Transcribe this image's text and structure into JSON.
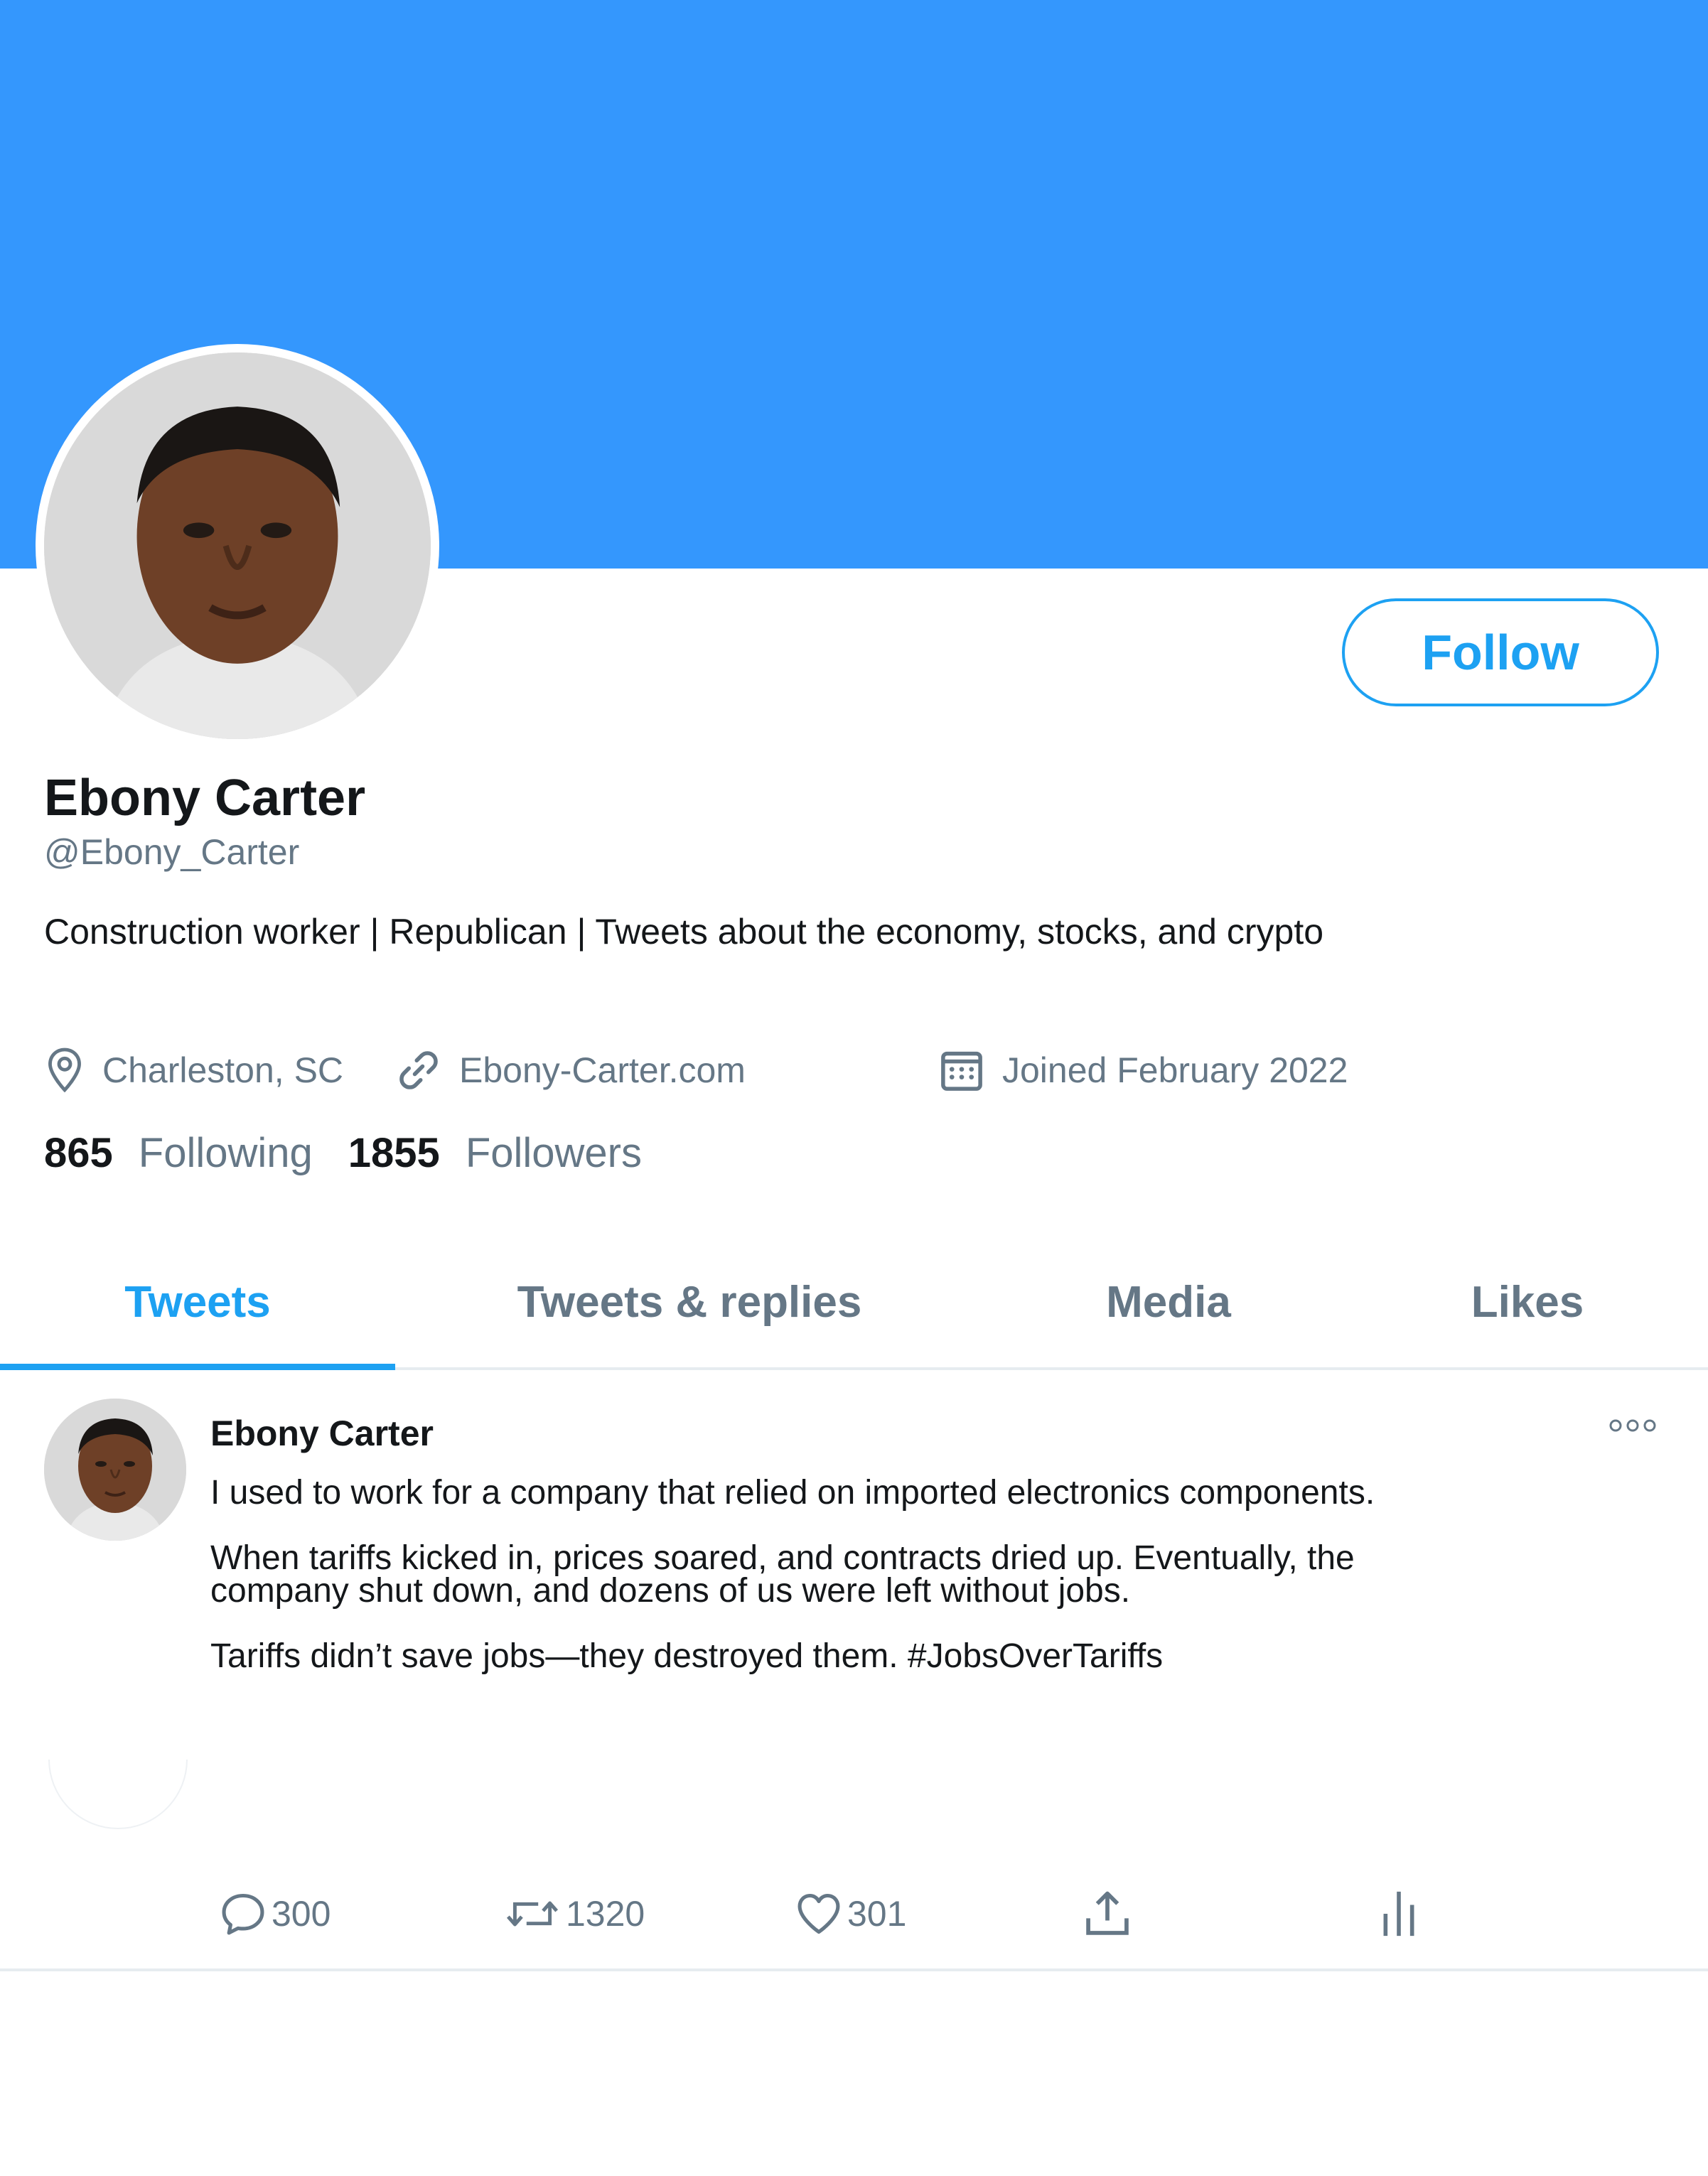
{
  "colors": {
    "banner": "#3497fd",
    "accent": "#1da1f2",
    "secondary_text": "#657786",
    "divider": "#e6ecf0"
  },
  "profile": {
    "name": "Ebony Carter",
    "handle": "@Ebony_Carter",
    "bio": "Construction worker |  Republican | Tweets about the economy, stocks, and crypto",
    "location": "Charleston, SC",
    "website": "Ebony-Carter.com",
    "joined": "Joined February 2022",
    "following_count": "865",
    "following_label": "Following",
    "followers_count": "1855",
    "followers_label": "Followers",
    "follow_label": "Follow"
  },
  "icons": {
    "location": "location-pin-icon",
    "link": "link-icon",
    "calendar": "calendar-icon",
    "more": "more-options-icon",
    "reply": "reply-icon",
    "retweet": "retweet-icon",
    "like": "heart-icon",
    "share": "share-icon",
    "analytics": "analytics-icon"
  },
  "tabs": [
    {
      "label": "Tweets",
      "active": true
    },
    {
      "label": "Tweets & replies",
      "active": false
    },
    {
      "label": "Media",
      "active": false
    },
    {
      "label": "Likes",
      "active": false
    }
  ],
  "tweet": {
    "author": "Ebony Carter",
    "paragraphs": [
      "I used to work for a company that relied on imported electronics components.",
      "When tariffs kicked in, prices soared, and contracts dried up. Eventually, the",
      "company shut down, and dozens of us were left without jobs.",
      "Tariffs didn’t save jobs—they destroyed them. #JobsOverTariffs"
    ],
    "reply_count": "300",
    "retweet_count": "1320",
    "like_count": "301"
  }
}
